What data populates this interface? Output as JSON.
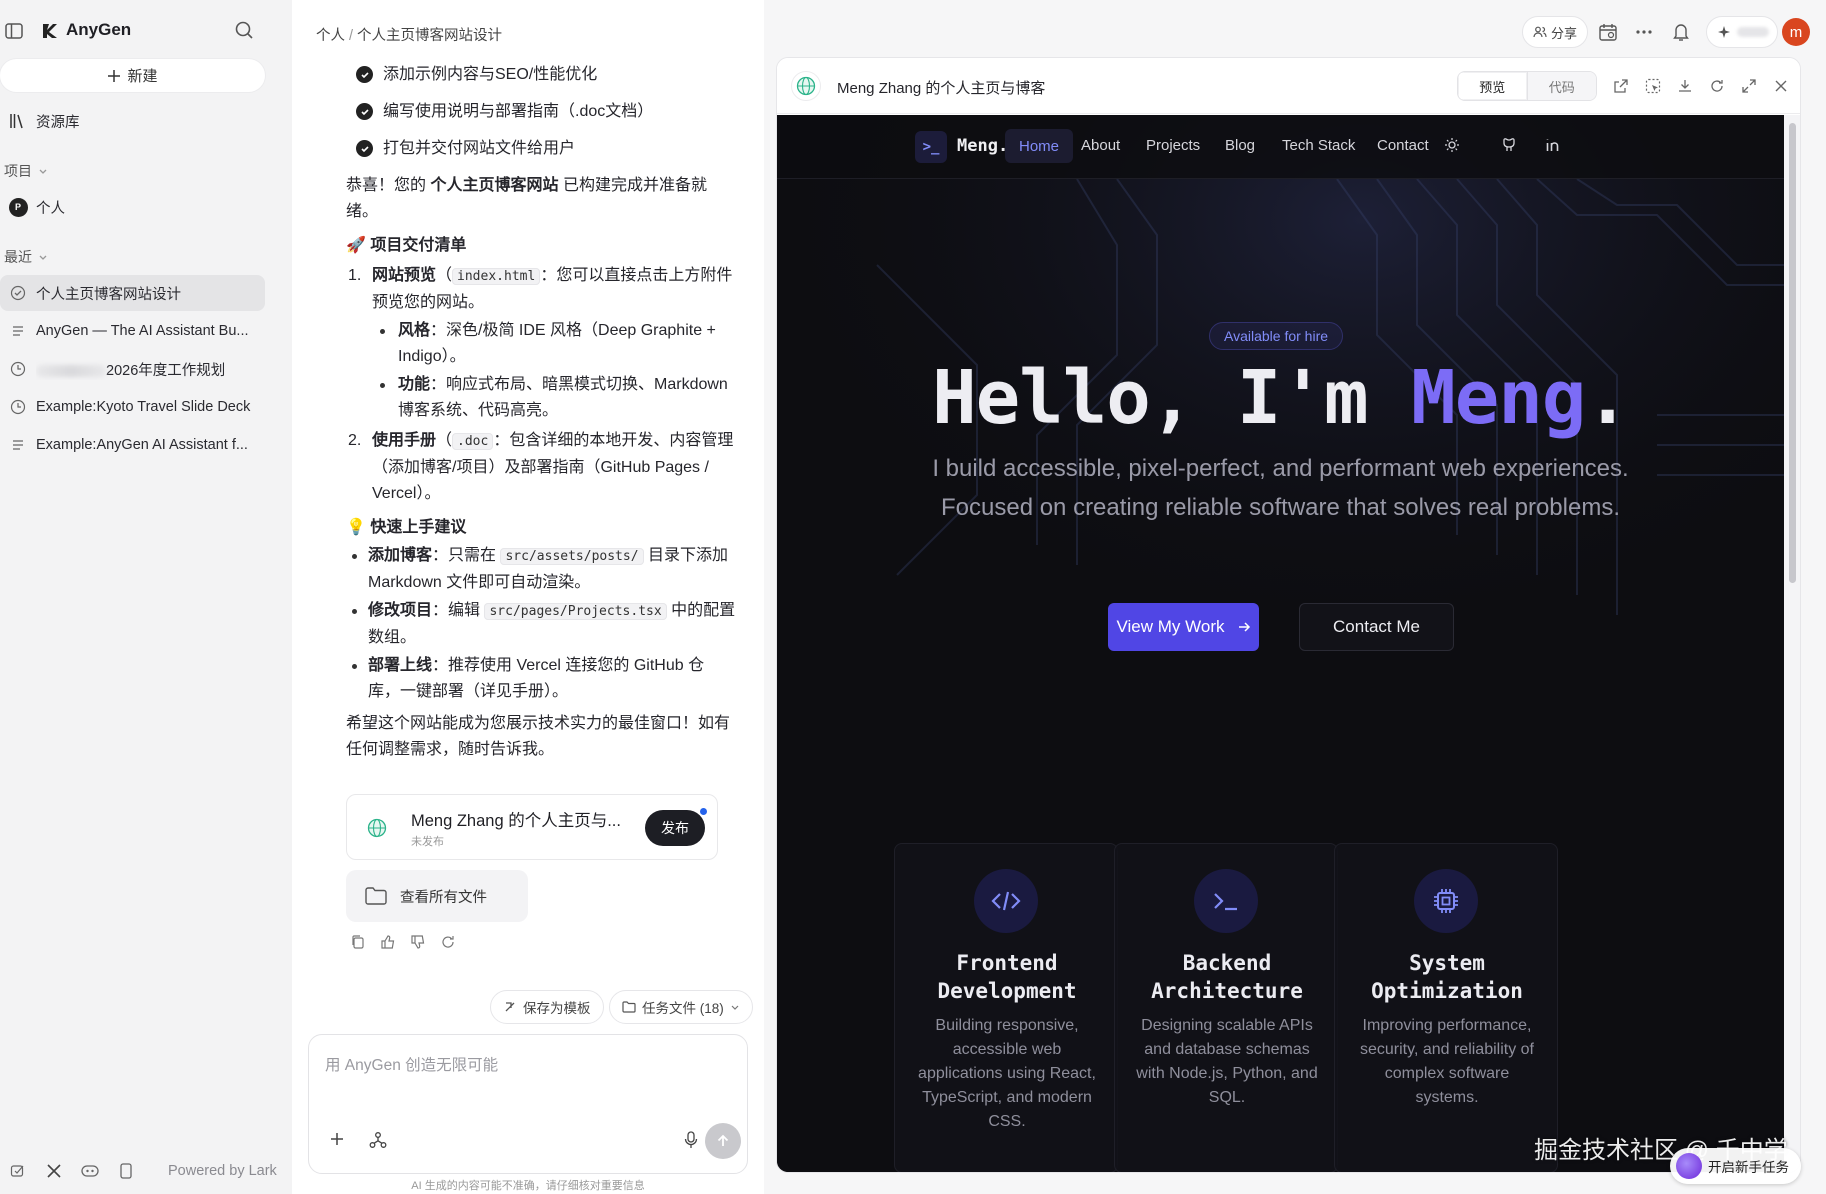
{
  "app": {
    "name": "AnyGen"
  },
  "sidebar": {
    "new_label": "新建",
    "library_label": "资源库",
    "projects_label": "项目",
    "project_avatar": "P",
    "project_name": "个人",
    "recent_label": "最近",
    "recent_items": [
      {
        "label": "个人主页博客网站设计",
        "icon": "check-circle-icon",
        "active": true
      },
      {
        "label": "AnyGen — The AI Assistant Bu...",
        "icon": "doc-icon"
      },
      {
        "label": "2026年度工作规划",
        "icon": "clock-icon"
      },
      {
        "label": "Example:Kyoto Travel Slide Deck",
        "icon": "clock-icon"
      },
      {
        "label": "Example:AnyGen AI Assistant f...",
        "icon": "doc-icon"
      }
    ],
    "powered_by": "Powered by Lark"
  },
  "chat": {
    "breadcrumb_root": "个人",
    "breadcrumb_sep": "/",
    "breadcrumb_current": "个人主页博客网站设计",
    "checklist": [
      "添加示例内容与SEO/性能优化",
      "编写使用说明与部署指南（.doc文档）",
      "打包并交付网站文件给用户"
    ],
    "congrats_pre": "恭喜！您的",
    "congrats_bold": "个人主页博客网站",
    "congrats_post": "已构建完成并准备就绪。",
    "delivery_heading": "🚀 项目交付清单",
    "item1_num": "1.",
    "item1_bold": "网站预览",
    "item1_code": "index.html",
    "item1_text": "：您可以直接点击上方附件预览您的网站。",
    "style_bold": "风格",
    "style_text": "：深色/极简 IDE 风格（Deep Graphite + Indigo）。",
    "feature_bold": "功能",
    "feature_text": "：响应式布局、暗黑模式切换、Markdown 博客系统、代码高亮。",
    "item2_num": "2.",
    "item2_bold": "使用手册",
    "item2_code": ".doc",
    "item2_text": "：包含详细的本地开发、内容管理（添加博客/项目）及部署指南（GitHub Pages / Vercel）。",
    "tips_heading": "💡 快速上手建议",
    "tip1_bold": "添加博客",
    "tip1_pre": "：只需在",
    "tip1_code": "src/assets/posts/",
    "tip1_post": "目录下添加 Markdown 文件即可自动渲染。",
    "tip2_bold": "修改项目",
    "tip2_pre": "：编辑",
    "tip2_code": "src/pages/Projects.tsx",
    "tip2_post": "中的配置数组。",
    "tip3_bold": "部署上线",
    "tip3_text": "：推荐使用 Vercel 连接您的 GitHub 仓库，一键部署（详见手册）。",
    "closing": "希望这个网站能成为您展示技术实力的最佳窗口！如有任何调整需求，随时告诉我。",
    "artifact_title": "Meng Zhang 的个人主页与...",
    "artifact_status": "未发布",
    "publish_label": "发布",
    "view_files_label": "查看所有文件",
    "save_template_label": "保存为模板",
    "task_files_label": "任务文件 (18)",
    "composer_placeholder": "用 AnyGen 创造无限可能",
    "disclaimer": "AI 生成的内容可能不准确，请仔细核对重要信息"
  },
  "topbar": {
    "share_label": "分享",
    "avatar_letter": "m"
  },
  "preview": {
    "title": "Meng Zhang 的个人主页与博客",
    "tab_preview": "预览",
    "tab_code": "代码",
    "site": {
      "brand_icon": ">_",
      "brand": "Meng.dev",
      "nav": [
        "Home",
        "About",
        "Projects",
        "Blog",
        "Tech Stack",
        "Contact"
      ],
      "badge": "Available for hire",
      "hero_pre": "Hello, I'm ",
      "hero_name": "Meng",
      "hero_post": ".",
      "hero_sub": "I build accessible, pixel-perfect, and performant web experiences. Focused on creating reliable software that solves real problems.",
      "cta_primary": "View My Work",
      "cta_secondary": "Contact Me",
      "cards": [
        {
          "title": "Frontend Development",
          "desc": "Building responsive, accessible web applications using React, TypeScript, and modern CSS.",
          "icon": "code-icon"
        },
        {
          "title": "Backend Architecture",
          "desc": "Designing scalable APIs and database schemas with Node.js, Python, and SQL.",
          "icon": "terminal-icon"
        },
        {
          "title": "System Optimization",
          "desc": "Improving performance, security, and reliability of complex software systems.",
          "icon": "cpu-icon"
        }
      ],
      "accent_color": "#7c6cf6",
      "primary_button_color": "#5046e5"
    }
  },
  "overlay": {
    "watermark": "掘金技术社区 @ 千中学",
    "new_task_label": "开启新手任务"
  }
}
